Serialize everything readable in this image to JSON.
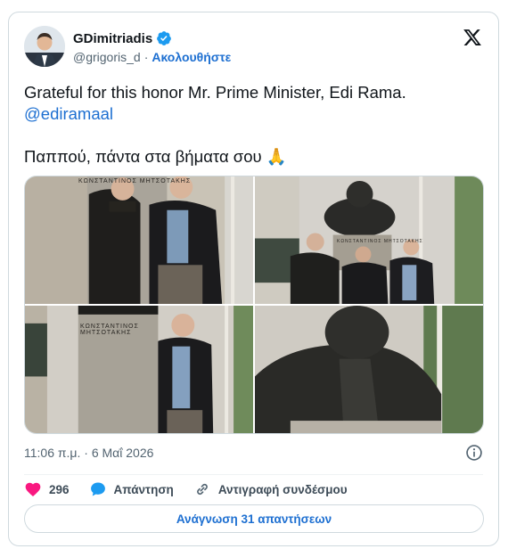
{
  "author": {
    "display_name": "GDimitriadis",
    "handle": "@grigoris_d",
    "separator": "·",
    "follow_label": "Ακολουθήστε"
  },
  "tweet": {
    "line1": "Grateful for this honor Mr. Prime Minister, Edi Rama.",
    "mention": "@ediramaal",
    "line3": "Παππού, πάντα στα βήματα σου 🙏"
  },
  "photos": [
    {
      "plaque": "ΚΩΝΣΤΑΝΤΙΝΟΣ ΜΗΤΣΟΤΑΚΗΣ"
    },
    {
      "plaque": "ΚΩΝΣΤΑΝΤΙΝΟΣ ΜΗΤΣΟΤΑΚΗΣ"
    },
    {
      "plaque": "ΚΩΝΣΤΑΝΤΙΝΟΣ ΜΗΤΣΟΤΑΚΗΣ"
    },
    {
      "plaque": ""
    }
  ],
  "timestamp": "11:06 π.μ. · 6 Μαΐ 2026",
  "actions": {
    "like_count": "296",
    "reply_label": "Απάντηση",
    "copy_link_label": "Αντιγραφή συνδέσμου"
  },
  "read_replies_label": "Ανάγνωση 31 απαντήσεων",
  "colors": {
    "accent": "#1d9bf0",
    "like": "#f91880",
    "border": "#cfd9de"
  }
}
